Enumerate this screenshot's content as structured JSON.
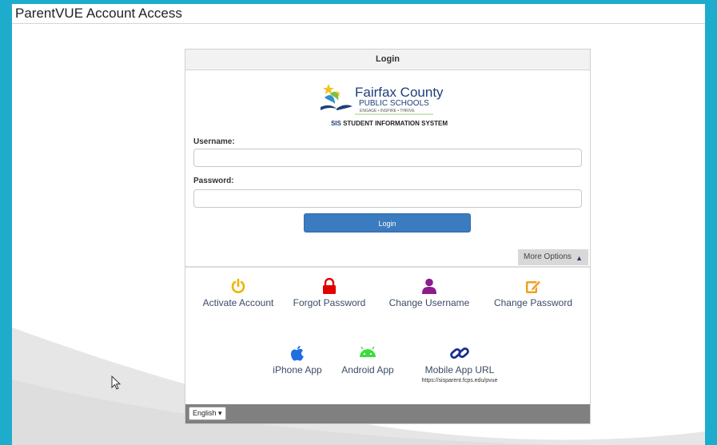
{
  "header": {
    "title": "ParentVUE Account Access"
  },
  "login_panel": {
    "title": "Login",
    "logo": {
      "name_line1": "Fairfax County",
      "name_line2": "PUBLIC SCHOOLS",
      "tagline": "ENGAGE • INSPIRE • THRIVE",
      "sis_abbrev": "SIS",
      "sis_text": "STUDENT INFORMATION SYSTEM"
    },
    "username_label": "Username:",
    "username_value": "",
    "password_label": "Password:",
    "password_value": "",
    "login_button": "Login",
    "more_options": "More Options"
  },
  "options": [
    {
      "label": "Activate Account",
      "icon": "power-icon",
      "color": "#f0b400"
    },
    {
      "label": "Forgot Password",
      "icon": "lock-icon",
      "color": "#e00000"
    },
    {
      "label": "Change Username",
      "icon": "user-icon",
      "color": "#8b1d8b"
    },
    {
      "label": "Change Password",
      "icon": "edit-icon",
      "color": "#f0a020"
    }
  ],
  "apps": [
    {
      "label": "iPhone App",
      "icon": "apple-icon",
      "color": "#1f6fe0"
    },
    {
      "label": "Android App",
      "icon": "android-icon",
      "color": "#3ddc3d"
    },
    {
      "label": "Mobile App URL",
      "icon": "link-icon",
      "color": "#1a2e8c",
      "url": "https://sisparent.fcps.edu/pvue"
    }
  ],
  "footer": {
    "language": "English"
  }
}
